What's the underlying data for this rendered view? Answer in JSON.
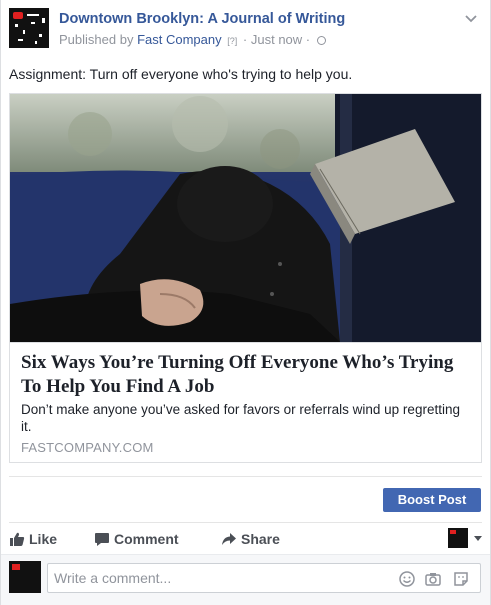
{
  "post": {
    "page_name": "Downtown Brooklyn: A Journal of Writing",
    "published_prefix": "Published by",
    "publisher": "Fast Company",
    "help_marker": "[?]",
    "separator": "·",
    "time": "Just now",
    "privacy_icon": "globe-icon",
    "status_text": "Assignment: Turn off everyone who's trying to help you."
  },
  "link_card": {
    "title": "Six Ways You’re Turning Off Everyone Who’s Trying To Help You Find A Job",
    "description": "Don’t make anyone you’ve asked for favors or referrals wind up regretting it.",
    "domain": "FASTCOMPANY.COM",
    "image_description_icon": "photo-woman-with-book-on-train"
  },
  "boost_button": {
    "label": "Boost Post",
    "color": "#4267b2"
  },
  "actions": {
    "like_label": "Like",
    "comment_label": "Comment",
    "share_label": "Share"
  },
  "comment_box": {
    "placeholder": "Write a comment..."
  },
  "colors": {
    "link_blue": "#365899",
    "meta_gray": "#90949c",
    "action_gray": "#4b4f56",
    "border": "#dddfe2"
  }
}
